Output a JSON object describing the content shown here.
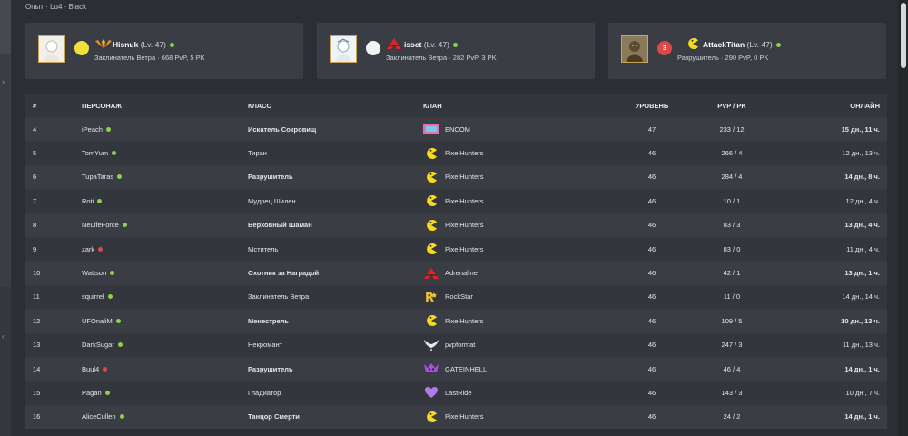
{
  "breadcrumb": "Опыт · Lu4 · Black",
  "colors": {
    "online": "#8fd14f",
    "offline": "#e0474c",
    "accent_gold": "#c9a45a"
  },
  "top_cards": [
    {
      "name": "Hisnuk",
      "level": "(Lv. 47)",
      "online": true,
      "subtitle": "Заклинатель Ветра · 668 PvP, 5 PK",
      "clan_icon": "phoenix-wings-icon",
      "badge": "",
      "badge_color": "#f2e03a"
    },
    {
      "name": "isset",
      "level": "(Lv. 47)",
      "online": true,
      "subtitle": "Заклинатель Ветра · 282 PvP, 3 PK",
      "clan_icon": "adrenaline-a-icon",
      "badge": "",
      "badge_color": "#f2f2f2"
    },
    {
      "name": "AttackTitan",
      "level": "(Lv. 47)",
      "online": true,
      "subtitle": "Разрушитель · 290 PvP, 0 PK",
      "clan_icon": "pacman-icon",
      "badge": "3",
      "badge_color": "#e04848"
    }
  ],
  "table": {
    "headers": [
      "#",
      "ПЕРСОНАЖ",
      "КЛАСС",
      "КЛАН",
      "УРОВЕНЬ",
      "PVP / PK",
      "ОНЛАЙН"
    ],
    "rows": [
      {
        "num": "4",
        "name": "iPeach",
        "online": true,
        "class": "Искатель Сокровищ",
        "class_bold": true,
        "clan": "ENCOM",
        "clan_icon": "encom-logo-icon",
        "level": "47",
        "pvp": "233 / 12",
        "online_time": "15 дн., 11 ч.",
        "time_bold": true
      },
      {
        "num": "5",
        "name": "TomYum",
        "online": true,
        "class": "Тиран",
        "class_bold": false,
        "clan": "PixelHunters",
        "clan_icon": "pacman-icon",
        "level": "46",
        "pvp": "266 / 4",
        "online_time": "12 дн., 13 ч.",
        "time_bold": false
      },
      {
        "num": "6",
        "name": "TupaTaras",
        "online": true,
        "class": "Разрушитель",
        "class_bold": true,
        "clan": "PixelHunters",
        "clan_icon": "pacman-icon",
        "level": "46",
        "pvp": "284 / 4",
        "online_time": "14 дн., 8 ч.",
        "time_bold": true
      },
      {
        "num": "7",
        "name": "Roti",
        "online": true,
        "class": "Мудрец Шилен",
        "class_bold": false,
        "clan": "PixelHunters",
        "clan_icon": "pacman-icon",
        "level": "46",
        "pvp": "10 / 1",
        "online_time": "12 дн., 4 ч.",
        "time_bold": false
      },
      {
        "num": "8",
        "name": "NeLifeForce",
        "online": true,
        "class": "Верховный Шаман",
        "class_bold": true,
        "clan": "PixelHunters",
        "clan_icon": "pacman-icon",
        "level": "46",
        "pvp": "83 / 3",
        "online_time": "13 дн., 4 ч.",
        "time_bold": true
      },
      {
        "num": "9",
        "name": "zark",
        "online": false,
        "class": "Мститель",
        "class_bold": false,
        "clan": "PixelHunters",
        "clan_icon": "pacman-icon",
        "level": "46",
        "pvp": "83 / 0",
        "online_time": "11 дн., 4 ч.",
        "time_bold": false
      },
      {
        "num": "10",
        "name": "Wattson",
        "online": true,
        "class": "Охотник за Наградой",
        "class_bold": true,
        "clan": "Adrenaline",
        "clan_icon": "adrenaline-a-icon",
        "level": "46",
        "pvp": "42 / 1",
        "online_time": "13 дн., 1 ч.",
        "time_bold": true
      },
      {
        "num": "11",
        "name": "squirrel",
        "online": true,
        "class": "Заклинатель Ветра",
        "class_bold": false,
        "clan": "RockStar",
        "clan_icon": "rockstar-r-icon",
        "level": "46",
        "pvp": "11 / 0",
        "online_time": "14 дн., 14 ч.",
        "time_bold": false
      },
      {
        "num": "12",
        "name": "UFOnaliM",
        "online": true,
        "class": "Менестрель",
        "class_bold": true,
        "clan": "PixelHunters",
        "clan_icon": "pacman-icon",
        "level": "46",
        "pvp": "109 / 5",
        "online_time": "10 дн., 13 ч.",
        "time_bold": true
      },
      {
        "num": "13",
        "name": "DarkSugar",
        "online": true,
        "class": "Некромант",
        "class_bold": false,
        "clan": "pvpformat",
        "clan_icon": "white-wings-icon",
        "level": "46",
        "pvp": "247 / 3",
        "online_time": "11 дн., 13 ч.",
        "time_bold": false
      },
      {
        "num": "14",
        "name": "Buul4",
        "online": false,
        "class": "Разрушитель",
        "class_bold": true,
        "clan": "GATEINHELL",
        "clan_icon": "purple-skull-icon",
        "level": "46",
        "pvp": "46 / 4",
        "online_time": "14 дн., 1 ч.",
        "time_bold": true
      },
      {
        "num": "15",
        "name": "Pagan",
        "online": true,
        "class": "Гладиатор",
        "class_bold": false,
        "clan": "LastRide",
        "clan_icon": "purple-heart-icon",
        "level": "46",
        "pvp": "143 / 3",
        "online_time": "10 дн., 7 ч.",
        "time_bold": false
      },
      {
        "num": "16",
        "name": "AliceCullen",
        "online": true,
        "class": "Танцор Смерти",
        "class_bold": true,
        "clan": "PixelHunters",
        "clan_icon": "pacman-icon",
        "level": "46",
        "pvp": "24 / 2",
        "online_time": "14 дн., 1 ч.",
        "time_bold": true
      }
    ]
  }
}
